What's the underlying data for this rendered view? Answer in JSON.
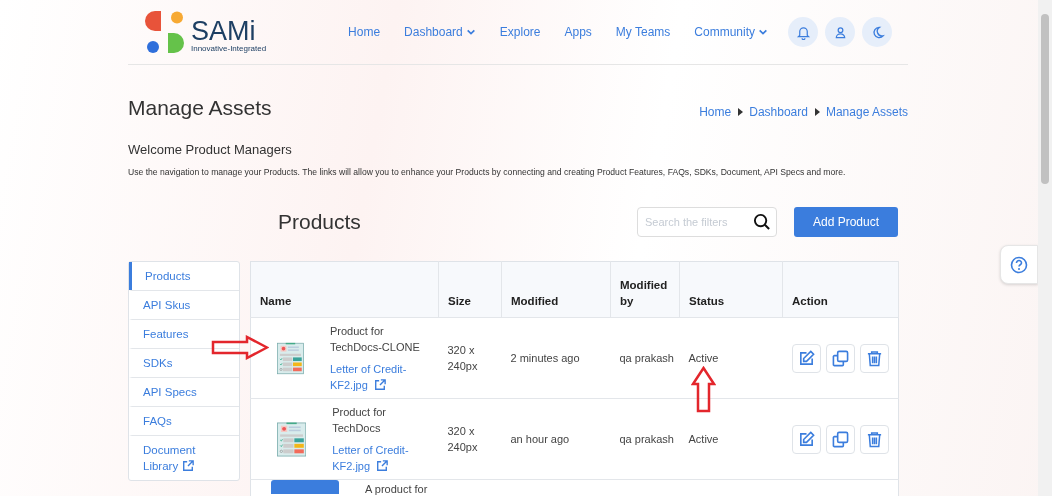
{
  "header": {
    "logo": {
      "name": "SAMi",
      "tagline": "Innovative-Integrated"
    },
    "nav": [
      {
        "label": "Home",
        "dropdown": false
      },
      {
        "label": "Dashboard",
        "dropdown": true
      },
      {
        "label": "Explore",
        "dropdown": false
      },
      {
        "label": "Apps",
        "dropdown": false
      },
      {
        "label": "My Teams",
        "dropdown": false
      },
      {
        "label": "Community",
        "dropdown": true
      }
    ]
  },
  "page": {
    "title": "Manage Assets",
    "breadcrumb": [
      "Home",
      "Dashboard",
      "Manage Assets"
    ],
    "welcome": "Welcome Product Managers",
    "description": "Use the navigation to manage your Products. The links will allow you to enhance your Products by connecting and creating Product Features, FAQs, SDKs, Document, API Specs and more."
  },
  "products": {
    "heading": "Products",
    "search": {
      "placeholder": "Search the filters"
    },
    "add_button": "Add Product",
    "sidebar": {
      "items": [
        {
          "label": "Products",
          "selected": true,
          "external": false
        },
        {
          "label": "API Skus",
          "selected": false,
          "external": false
        },
        {
          "label": "Features",
          "selected": false,
          "external": false
        },
        {
          "label": "SDKs",
          "selected": false,
          "external": false
        },
        {
          "label": "API Specs",
          "selected": false,
          "external": false
        },
        {
          "label": "FAQs",
          "selected": false,
          "external": false
        },
        {
          "label": "Document Library",
          "selected": false,
          "external": true
        }
      ]
    },
    "table": {
      "columns": [
        "Name",
        "Size",
        "Modified",
        "Modified by",
        "Status",
        "Action"
      ],
      "rows": [
        {
          "kind": "document",
          "name": "Product for TechDocs-CLONE",
          "file": "Letter of Credit-KF2.jpg",
          "size": "320 x 240px",
          "modified": "2 minutes ago",
          "modified_by": "qa prakash",
          "status": "Active"
        },
        {
          "kind": "document",
          "name": "Product for TechDocs",
          "file": "Letter of Credit-KF2.jpg",
          "size": "320 x 240px",
          "modified": "an hour ago",
          "modified_by": "qa prakash",
          "status": "Active"
        },
        {
          "kind": "partial",
          "name": "A product for"
        }
      ]
    }
  },
  "annotations": [
    {
      "kind": "arrow-right"
    },
    {
      "kind": "arrow-up"
    }
  ]
}
